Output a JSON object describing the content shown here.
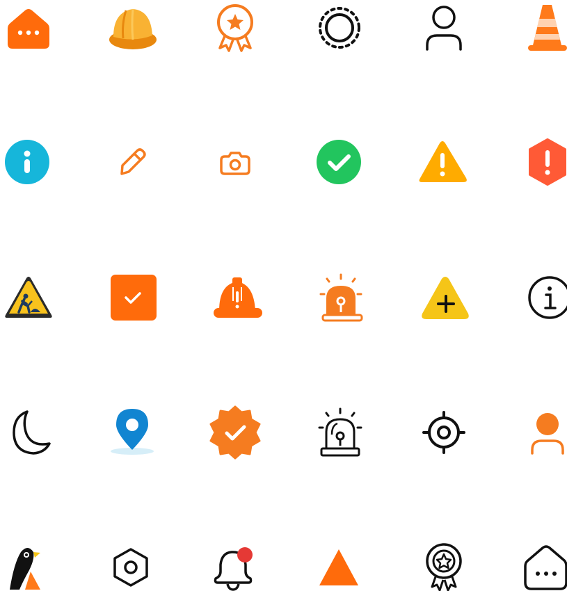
{
  "icons": [
    {
      "name": "chat-bubble-dots-icon",
      "color": "#FF6B0B"
    },
    {
      "name": "hard-hat-icon",
      "color": "#F9B233"
    },
    {
      "name": "award-ribbon-star-icon",
      "color": "#F57C20"
    },
    {
      "name": "loading-circle-icon",
      "color": "#111111"
    },
    {
      "name": "user-outline-icon",
      "color": "#111111"
    },
    {
      "name": "traffic-cone-icon",
      "color": "#FF7A1A"
    },
    {
      "name": "info-circle-icon",
      "color": "#16B6DA"
    },
    {
      "name": "pencil-icon",
      "color": "#F57C20"
    },
    {
      "name": "camera-icon",
      "color": "#F57C20"
    },
    {
      "name": "check-circle-icon",
      "color": "#22C55E"
    },
    {
      "name": "warning-triangle-icon",
      "color": "#FFAB00"
    },
    {
      "name": "error-hexagon-icon",
      "color": "#FF5A36"
    },
    {
      "name": "road-work-sign-icon",
      "color": "#F8C21D"
    },
    {
      "name": "checkbox-checked-icon",
      "color": "#FF6B0B"
    },
    {
      "name": "hard-hat-alert-icon",
      "color": "#FF6B0B"
    },
    {
      "name": "alarm-siren-icon",
      "color": "#F57C20"
    },
    {
      "name": "add-triangle-icon",
      "color": "#F5C518"
    },
    {
      "name": "info-outline-icon",
      "color": "#111111"
    },
    {
      "name": "moon-icon",
      "color": "#111111"
    },
    {
      "name": "location-pin-icon",
      "color": "#1185D1"
    },
    {
      "name": "verified-badge-icon",
      "color": "#F57C20"
    },
    {
      "name": "alarm-siren-outline-icon",
      "color": "#111111"
    },
    {
      "name": "crosshair-target-icon",
      "color": "#111111"
    },
    {
      "name": "user-solid-icon",
      "color": "#F57C20"
    },
    {
      "name": "penguin-bird-logo-icon",
      "color": "#111111"
    },
    {
      "name": "hex-nut-icon",
      "color": "#111111"
    },
    {
      "name": "notification-bell-icon",
      "color": "#E53935"
    },
    {
      "name": "triangle-icon",
      "color": "#FF6B0B"
    },
    {
      "name": "award-ribbon-outline-icon",
      "color": "#111111"
    },
    {
      "name": "chat-bubble-outline-icon",
      "color": "#111111"
    }
  ]
}
